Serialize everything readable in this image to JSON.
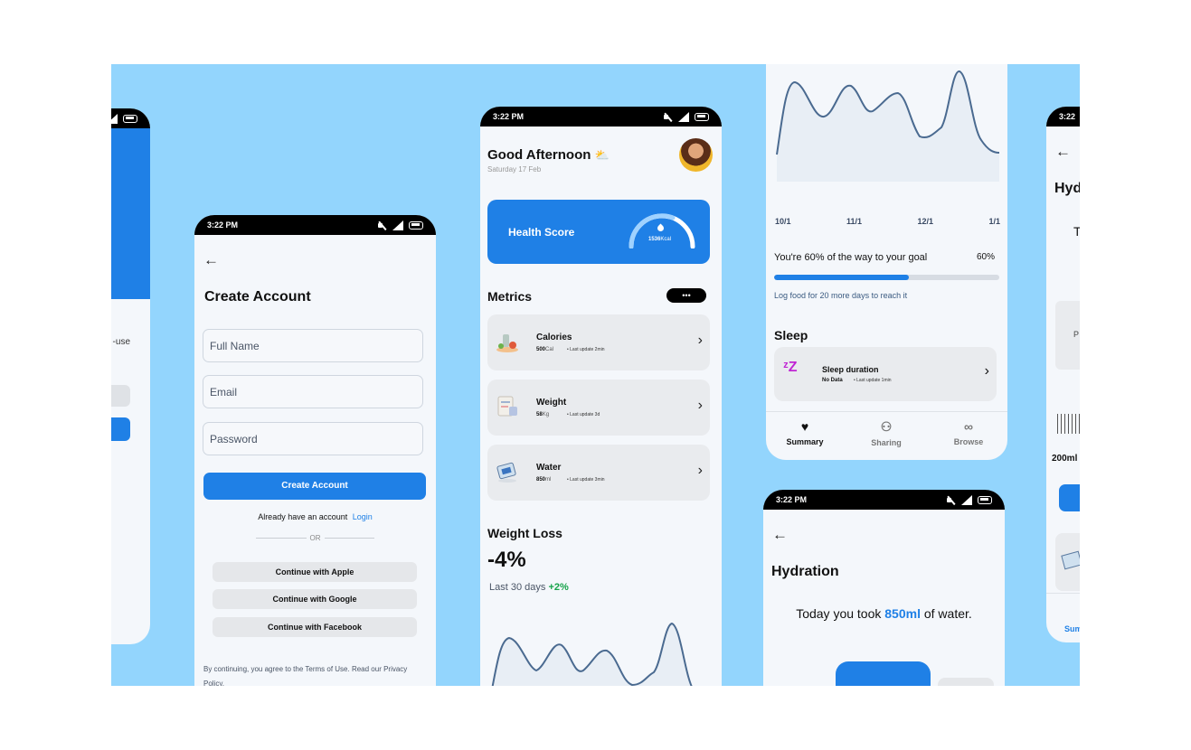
{
  "status": {
    "time": "3:22 PM",
    "time_short": "3:22"
  },
  "left_partial": {
    "snippet": "-use"
  },
  "create_account": {
    "back": "←",
    "title": "Create Account",
    "full_name_placeholder": "Full Name",
    "email_placeholder": "Email",
    "password_placeholder": "Password",
    "submit_label": "Create Account",
    "have_account": "Already have an account",
    "login_link": "Login",
    "or": "OR",
    "apple": "Continue with Apple",
    "google": "Continue with Google",
    "facebook": "Continue with Facebook",
    "terms": "By continuing, you agree to the Terms of Use. Read our Privacy Policy."
  },
  "dashboard": {
    "greeting": "Good Afternoon",
    "weather_icon": "sun-cloud-icon",
    "date": "Saturday 17 Feb",
    "health_score_label": "Health Score",
    "health_score_value": "1536",
    "health_score_unit": "Kcal",
    "metrics_title": "Metrics",
    "more": "•••",
    "metrics": [
      {
        "name": "Calories",
        "value": "500",
        "unit": "Cal",
        "update": "Last update 2min",
        "icon": "food-icon"
      },
      {
        "name": "Weight",
        "value": "58",
        "unit": "Kg",
        "update": "Last update 3d",
        "icon": "scale-icon"
      },
      {
        "name": "Water",
        "value": "850",
        "unit": "ml",
        "update": "Last update 3min",
        "icon": "water-icon"
      }
    ],
    "weight_loss_title": "Weight Loss",
    "weight_loss_value": "-4%",
    "weight_loss_period": "Last 30 days",
    "weight_loss_change": "+2%"
  },
  "summary": {
    "x_labels": [
      "10/1",
      "11/1",
      "12/1",
      "1/1"
    ],
    "goal_text": "You're 60% of the way to your goal",
    "goal_percent": "60%",
    "goal_progress": 0.6,
    "goal_hint": "Log food for 20 more days to reach it",
    "sleep_title": "Sleep",
    "sleep_label": "Sleep duration",
    "sleep_value": "No Data",
    "sleep_update": "Last update 1min",
    "nav": [
      {
        "label": "Summary",
        "icon": "heart-icon"
      },
      {
        "label": "Sharing",
        "icon": "people-icon"
      },
      {
        "label": "Browse",
        "icon": "binoculars-icon"
      }
    ]
  },
  "hydration": {
    "back": "←",
    "title": "Hydration",
    "sentence_pre": "Today you took",
    "sentence_amount": "850ml",
    "sentence_post": "of water."
  },
  "right_partial": {
    "title": "Hyd",
    "letter": "T",
    "p": "P",
    "amount": "200ml",
    "nav": "Sum"
  },
  "colors": {
    "background": "#93d5fd",
    "accent": "#1f80e6",
    "positive": "#16a34a",
    "chart_line": "#4a6a90"
  }
}
